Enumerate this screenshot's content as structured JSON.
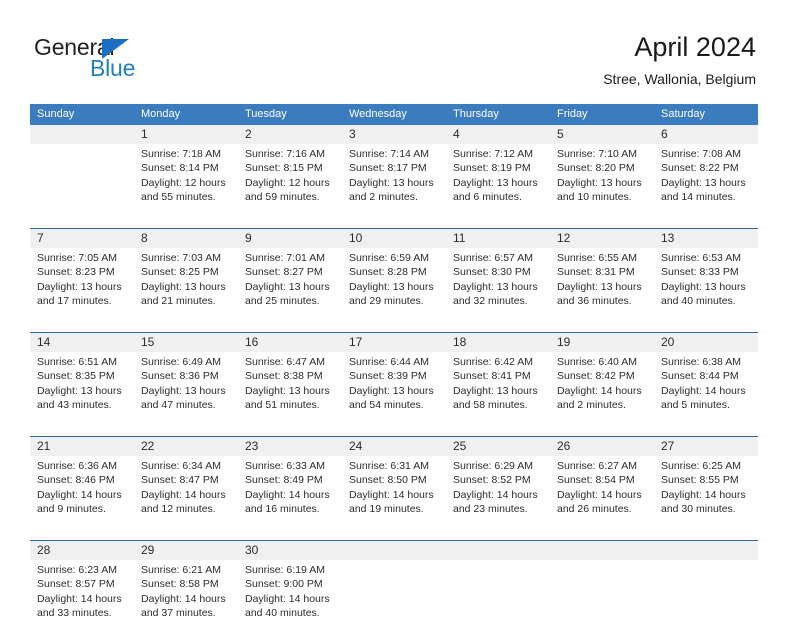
{
  "brand": {
    "name_top": "General",
    "name_bottom": "Blue",
    "accent_color": "#1f7ec4",
    "triangle_color": "#1b6ec2",
    "top_text_color": "#231f20"
  },
  "header": {
    "title": "April 2024",
    "subtitle": "Stree, Wallonia, Belgium"
  },
  "theme": {
    "header_row_bg": "#3a7cbd",
    "header_row_text": "#ffffff",
    "daynum_band_bg": "#f0f0f0",
    "week_separator": "#2e6da4",
    "body_text": "#2c2c2c"
  },
  "weekdays": [
    "Sunday",
    "Monday",
    "Tuesday",
    "Wednesday",
    "Thursday",
    "Friday",
    "Saturday"
  ],
  "weeks": [
    {
      "days": [
        {
          "num": "",
          "sunrise": "",
          "sunset": "",
          "daylight_1": "",
          "daylight_2": "",
          "empty": true
        },
        {
          "num": "1",
          "sunrise": "Sunrise: 7:18 AM",
          "sunset": "Sunset: 8:14 PM",
          "daylight_1": "Daylight: 12 hours",
          "daylight_2": "and 55 minutes."
        },
        {
          "num": "2",
          "sunrise": "Sunrise: 7:16 AM",
          "sunset": "Sunset: 8:15 PM",
          "daylight_1": "Daylight: 12 hours",
          "daylight_2": "and 59 minutes."
        },
        {
          "num": "3",
          "sunrise": "Sunrise: 7:14 AM",
          "sunset": "Sunset: 8:17 PM",
          "daylight_1": "Daylight: 13 hours",
          "daylight_2": "and 2 minutes."
        },
        {
          "num": "4",
          "sunrise": "Sunrise: 7:12 AM",
          "sunset": "Sunset: 8:19 PM",
          "daylight_1": "Daylight: 13 hours",
          "daylight_2": "and 6 minutes."
        },
        {
          "num": "5",
          "sunrise": "Sunrise: 7:10 AM",
          "sunset": "Sunset: 8:20 PM",
          "daylight_1": "Daylight: 13 hours",
          "daylight_2": "and 10 minutes."
        },
        {
          "num": "6",
          "sunrise": "Sunrise: 7:08 AM",
          "sunset": "Sunset: 8:22 PM",
          "daylight_1": "Daylight: 13 hours",
          "daylight_2": "and 14 minutes."
        }
      ]
    },
    {
      "days": [
        {
          "num": "7",
          "sunrise": "Sunrise: 7:05 AM",
          "sunset": "Sunset: 8:23 PM",
          "daylight_1": "Daylight: 13 hours",
          "daylight_2": "and 17 minutes."
        },
        {
          "num": "8",
          "sunrise": "Sunrise: 7:03 AM",
          "sunset": "Sunset: 8:25 PM",
          "daylight_1": "Daylight: 13 hours",
          "daylight_2": "and 21 minutes."
        },
        {
          "num": "9",
          "sunrise": "Sunrise: 7:01 AM",
          "sunset": "Sunset: 8:27 PM",
          "daylight_1": "Daylight: 13 hours",
          "daylight_2": "and 25 minutes."
        },
        {
          "num": "10",
          "sunrise": "Sunrise: 6:59 AM",
          "sunset": "Sunset: 8:28 PM",
          "daylight_1": "Daylight: 13 hours",
          "daylight_2": "and 29 minutes."
        },
        {
          "num": "11",
          "sunrise": "Sunrise: 6:57 AM",
          "sunset": "Sunset: 8:30 PM",
          "daylight_1": "Daylight: 13 hours",
          "daylight_2": "and 32 minutes."
        },
        {
          "num": "12",
          "sunrise": "Sunrise: 6:55 AM",
          "sunset": "Sunset: 8:31 PM",
          "daylight_1": "Daylight: 13 hours",
          "daylight_2": "and 36 minutes."
        },
        {
          "num": "13",
          "sunrise": "Sunrise: 6:53 AM",
          "sunset": "Sunset: 8:33 PM",
          "daylight_1": "Daylight: 13 hours",
          "daylight_2": "and 40 minutes."
        }
      ]
    },
    {
      "days": [
        {
          "num": "14",
          "sunrise": "Sunrise: 6:51 AM",
          "sunset": "Sunset: 8:35 PM",
          "daylight_1": "Daylight: 13 hours",
          "daylight_2": "and 43 minutes."
        },
        {
          "num": "15",
          "sunrise": "Sunrise: 6:49 AM",
          "sunset": "Sunset: 8:36 PM",
          "daylight_1": "Daylight: 13 hours",
          "daylight_2": "and 47 minutes."
        },
        {
          "num": "16",
          "sunrise": "Sunrise: 6:47 AM",
          "sunset": "Sunset: 8:38 PM",
          "daylight_1": "Daylight: 13 hours",
          "daylight_2": "and 51 minutes."
        },
        {
          "num": "17",
          "sunrise": "Sunrise: 6:44 AM",
          "sunset": "Sunset: 8:39 PM",
          "daylight_1": "Daylight: 13 hours",
          "daylight_2": "and 54 minutes."
        },
        {
          "num": "18",
          "sunrise": "Sunrise: 6:42 AM",
          "sunset": "Sunset: 8:41 PM",
          "daylight_1": "Daylight: 13 hours",
          "daylight_2": "and 58 minutes."
        },
        {
          "num": "19",
          "sunrise": "Sunrise: 6:40 AM",
          "sunset": "Sunset: 8:42 PM",
          "daylight_1": "Daylight: 14 hours",
          "daylight_2": "and 2 minutes."
        },
        {
          "num": "20",
          "sunrise": "Sunrise: 6:38 AM",
          "sunset": "Sunset: 8:44 PM",
          "daylight_1": "Daylight: 14 hours",
          "daylight_2": "and 5 minutes."
        }
      ]
    },
    {
      "days": [
        {
          "num": "21",
          "sunrise": "Sunrise: 6:36 AM",
          "sunset": "Sunset: 8:46 PM",
          "daylight_1": "Daylight: 14 hours",
          "daylight_2": "and 9 minutes."
        },
        {
          "num": "22",
          "sunrise": "Sunrise: 6:34 AM",
          "sunset": "Sunset: 8:47 PM",
          "daylight_1": "Daylight: 14 hours",
          "daylight_2": "and 12 minutes."
        },
        {
          "num": "23",
          "sunrise": "Sunrise: 6:33 AM",
          "sunset": "Sunset: 8:49 PM",
          "daylight_1": "Daylight: 14 hours",
          "daylight_2": "and 16 minutes."
        },
        {
          "num": "24",
          "sunrise": "Sunrise: 6:31 AM",
          "sunset": "Sunset: 8:50 PM",
          "daylight_1": "Daylight: 14 hours",
          "daylight_2": "and 19 minutes."
        },
        {
          "num": "25",
          "sunrise": "Sunrise: 6:29 AM",
          "sunset": "Sunset: 8:52 PM",
          "daylight_1": "Daylight: 14 hours",
          "daylight_2": "and 23 minutes."
        },
        {
          "num": "26",
          "sunrise": "Sunrise: 6:27 AM",
          "sunset": "Sunset: 8:54 PM",
          "daylight_1": "Daylight: 14 hours",
          "daylight_2": "and 26 minutes."
        },
        {
          "num": "27",
          "sunrise": "Sunrise: 6:25 AM",
          "sunset": "Sunset: 8:55 PM",
          "daylight_1": "Daylight: 14 hours",
          "daylight_2": "and 30 minutes."
        }
      ]
    },
    {
      "days": [
        {
          "num": "28",
          "sunrise": "Sunrise: 6:23 AM",
          "sunset": "Sunset: 8:57 PM",
          "daylight_1": "Daylight: 14 hours",
          "daylight_2": "and 33 minutes."
        },
        {
          "num": "29",
          "sunrise": "Sunrise: 6:21 AM",
          "sunset": "Sunset: 8:58 PM",
          "daylight_1": "Daylight: 14 hours",
          "daylight_2": "and 37 minutes."
        },
        {
          "num": "30",
          "sunrise": "Sunrise: 6:19 AM",
          "sunset": "Sunset: 9:00 PM",
          "daylight_1": "Daylight: 14 hours",
          "daylight_2": "and 40 minutes."
        },
        {
          "num": "",
          "sunrise": "",
          "sunset": "",
          "daylight_1": "",
          "daylight_2": "",
          "empty": true
        },
        {
          "num": "",
          "sunrise": "",
          "sunset": "",
          "daylight_1": "",
          "daylight_2": "",
          "empty": true
        },
        {
          "num": "",
          "sunrise": "",
          "sunset": "",
          "daylight_1": "",
          "daylight_2": "",
          "empty": true
        },
        {
          "num": "",
          "sunrise": "",
          "sunset": "",
          "daylight_1": "",
          "daylight_2": "",
          "empty": true
        }
      ]
    }
  ]
}
